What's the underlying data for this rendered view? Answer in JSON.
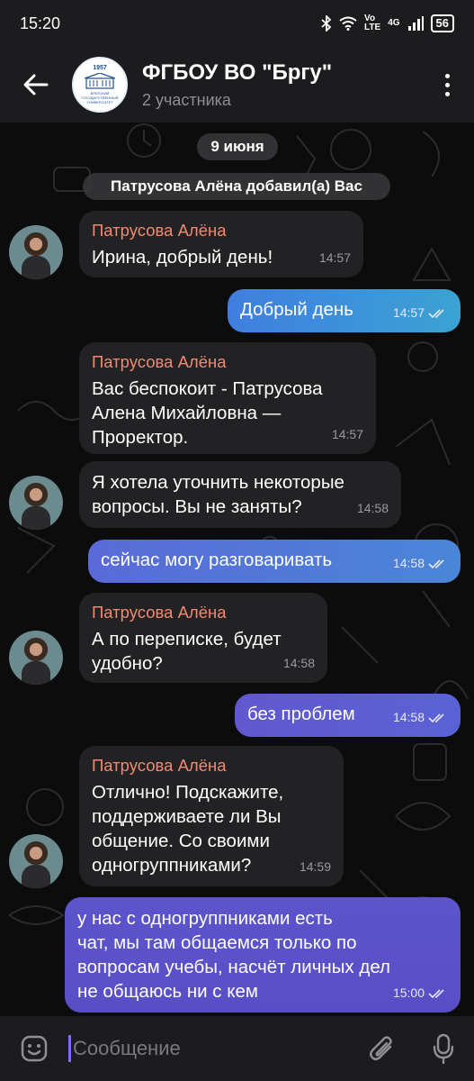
{
  "status": {
    "time": "15:20",
    "volte": "Vo\nLTE",
    "network": "4G",
    "battery": "56"
  },
  "header": {
    "title": "ФГБОУ ВО \"Бргу\"",
    "subtitle": "2 участника",
    "logo_year": "1957",
    "logo_text": "БРАТСКИЙ ГОСУДАРСТВЕННЫЙ УНИВЕРСИТЕТ"
  },
  "date_pill": "9 июня",
  "service_msg": "Патрусова Алёна добавил(а) Вас",
  "messages": [
    {
      "dir": "in",
      "sender": "Патрусова Алёна",
      "text": "Ирина, добрый день!",
      "time": "14:57"
    },
    {
      "dir": "out",
      "text": "Добрый день",
      "time": "14:57"
    },
    {
      "dir": "in",
      "sender": "Патрусова Алёна",
      "text": "Вас беспокоит - Патрусова\nАлена Михайловна —\nПроректор.",
      "time": "14:57"
    },
    {
      "dir": "in",
      "text": "Я хотела уточнить некоторые\nвопросы. Вы не заняты?",
      "time": "14:58"
    },
    {
      "dir": "out",
      "text": "сейчас могу разговаривать",
      "time": "14:58"
    },
    {
      "dir": "in",
      "sender": "Патрусова Алёна",
      "text": "А по переписке, будет\nудобно?",
      "time": "14:58"
    },
    {
      "dir": "out",
      "text": "без проблем",
      "time": "14:58"
    },
    {
      "dir": "in",
      "sender": "Патрусова Алёна",
      "text": "Отлично! Подскажите,\nподдерживаете ли Вы\nобщение. Со своими\nодногруппниками?",
      "time": "14:59"
    },
    {
      "dir": "out",
      "text": "у нас с одногруппниками есть\nчат, мы там общаемся только по\nвопросам учебы, насчёт личных дел\nне общаюсь ни с кем",
      "time": "15:00"
    }
  ],
  "input": {
    "placeholder": "Сообщение"
  },
  "icons": {
    "back": "arrow-left-icon",
    "menu": "more-vertical-icon",
    "emoji": "emoji-icon",
    "attach": "paperclip-icon",
    "mic": "microphone-icon",
    "read": "double-check-icon"
  },
  "colors": {
    "sender": "#ef8a72",
    "incoming": "#222224",
    "outgoing_top": "#3d8fd6",
    "outgoing_bottom": "#5b4ec9"
  }
}
